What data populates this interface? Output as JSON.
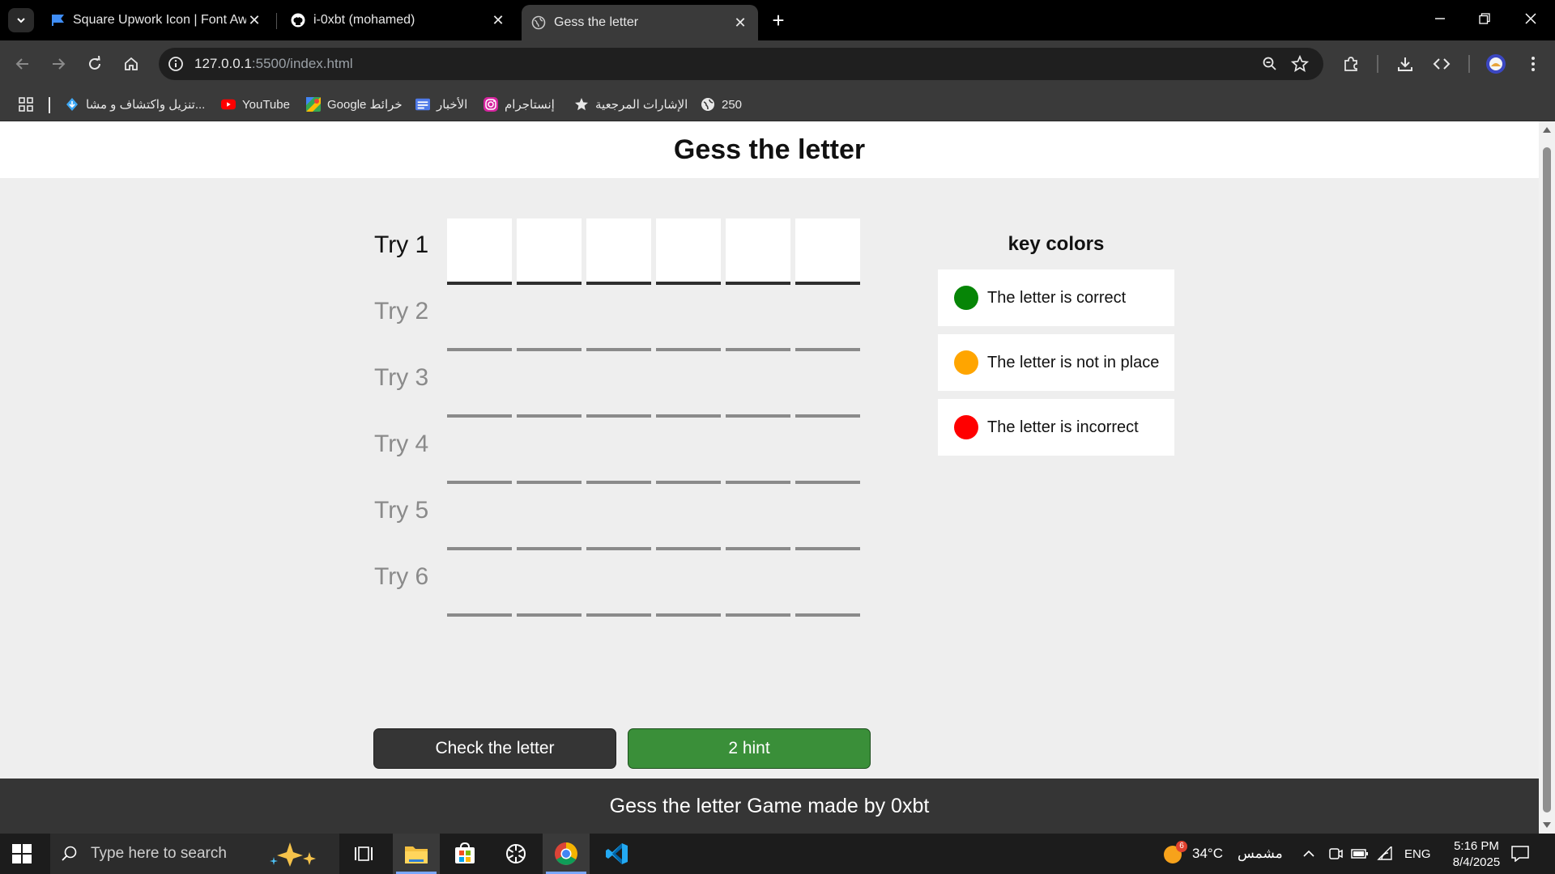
{
  "browser": {
    "tabs": [
      {
        "title": "Square Upwork Icon | Font Awe",
        "active": false
      },
      {
        "title": "i-0xbt (mohamed)",
        "active": false
      },
      {
        "title": "Gess the letter",
        "active": true
      }
    ],
    "url_host": "127.0.0.1",
    "url_rest": ":5500/index.html",
    "bookmarks": [
      {
        "label": "تنزيل واكتشاف و مشا...",
        "icon": "download-app-icon"
      },
      {
        "label": "YouTube",
        "icon": "youtube-icon"
      },
      {
        "label": "Google خرائط",
        "icon": "google-maps-icon"
      },
      {
        "label": "الأخبار",
        "icon": "news-icon"
      },
      {
        "label": "إنستاجرام",
        "icon": "instagram-icon"
      },
      {
        "label": "الإشارات المرجعية",
        "icon": "star-icon"
      },
      {
        "label": "250",
        "icon": "globe-icon"
      }
    ]
  },
  "page": {
    "title": "Gess the letter",
    "tries": [
      {
        "label": "Try 1",
        "active": true
      },
      {
        "label": "Try 2",
        "active": false
      },
      {
        "label": "Try 3",
        "active": false
      },
      {
        "label": "Try 4",
        "active": false
      },
      {
        "label": "Try 5",
        "active": false
      },
      {
        "label": "Try 6",
        "active": false
      }
    ],
    "letters_per_try": 6,
    "check_button": "Check the letter",
    "hint_button": "2 hint",
    "key_colors": {
      "heading": "key colors",
      "items": [
        {
          "label": "The letter is correct",
          "color": "#068506"
        },
        {
          "label": "The letter is not in place",
          "color": "#ffa500"
        },
        {
          "label": "The letter is incorrect",
          "color": "#ff0000"
        }
      ]
    },
    "footer": "Gess the letter Game made by 0xbt"
  },
  "taskbar": {
    "search_placeholder": "Type here to search",
    "weather_temp": "34°C",
    "weather_desc": "مشمس",
    "weather_badge": "6",
    "language": "ENG",
    "time": "5:16 PM",
    "date": "8/4/2025"
  }
}
